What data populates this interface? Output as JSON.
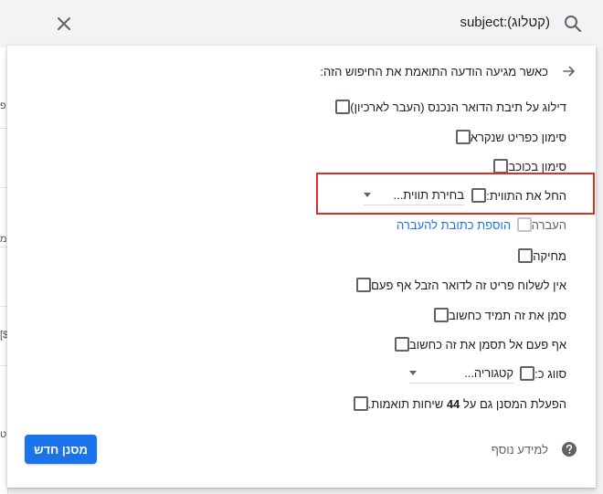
{
  "search": {
    "query": "subject:(קטלוג)",
    "icon": "search-icon",
    "close_icon": "close-icon"
  },
  "filter": {
    "header": "כאשר מגיעה הודעה התואמת את החיפוש הזה:",
    "options": [
      {
        "label": "דילוג על תיבת הדואר הנכנס (העבר לארכיון)",
        "checked": false
      },
      {
        "label": "סימון כפריט שנקרא",
        "checked": false
      },
      {
        "label": "סימון בכוכב",
        "checked": false
      },
      {
        "label": "החל את התווית:",
        "checked": false,
        "select_value": "בחירת תווית..."
      },
      {
        "label": "העברה",
        "checked": false,
        "disabled": true,
        "link": "הוספת כתובת להעברה"
      },
      {
        "label": "מחיקה",
        "checked": false
      },
      {
        "label": "אין לשלוח פריט זה לדואר הזבל אף פעם",
        "checked": false
      },
      {
        "label": "סמן את זה תמיד כחשוב",
        "checked": false
      },
      {
        "label": "אף פעם אל תסמן את זה כחשוב",
        "checked": false
      },
      {
        "label": "סווג כ:",
        "checked": false,
        "select_value": "קטגוריה..."
      },
      {
        "label_prefix": "הפעלת המסנן גם על",
        "label_count": "44",
        "label_suffix": "שיחות תואמות.",
        "checked": false
      }
    ],
    "help_label": "למידע נוסף",
    "create_button": "מסנן חדש"
  },
  "colors": {
    "accent": "#1a73e8",
    "highlight": "#d93025",
    "checkbox": "#5f6368"
  },
  "background_glyphs": [
    "פ",
    "מ",
    "[$",
    "ט"
  ]
}
